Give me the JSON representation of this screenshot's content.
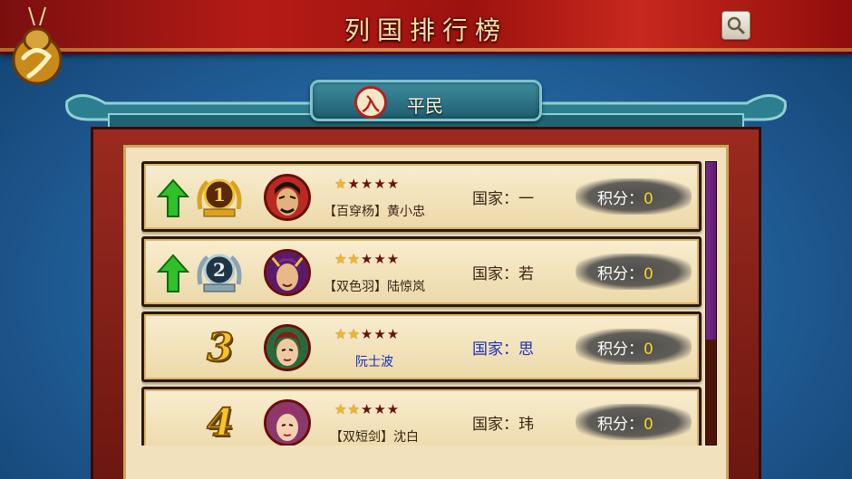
{
  "header": {
    "title": "列国排行榜"
  },
  "tab": {
    "badge": "入",
    "label": "平民"
  },
  "labels": {
    "country_prefix": "国家：",
    "score_prefix": "积分："
  },
  "rows": [
    {
      "rank": "1",
      "rank_style": "gold-medal",
      "trend": "up",
      "stars_filled": 1,
      "stars_total": 5,
      "name": "【百穿杨】黄小忠",
      "name_color": "default",
      "country": "一",
      "country_color": "default",
      "score": "0"
    },
    {
      "rank": "2",
      "rank_style": "silver-medal",
      "trend": "up",
      "stars_filled": 2,
      "stars_total": 5,
      "name": "【双色羽】陆惊岚",
      "name_color": "default",
      "country": "若",
      "country_color": "default",
      "score": "0"
    },
    {
      "rank": "3",
      "rank_style": "number",
      "trend": "none",
      "stars_filled": 2,
      "stars_total": 5,
      "name": "阮士波",
      "name_color": "blue",
      "country": "思",
      "country_color": "blue",
      "score": "0"
    },
    {
      "rank": "4",
      "rank_style": "number",
      "trend": "none",
      "stars_filled": 2,
      "stars_total": 5,
      "name": "【双短剑】沈白",
      "name_color": "default",
      "country": "玮",
      "country_color": "default",
      "score": "0"
    }
  ],
  "colors": {
    "accent_red": "#b5211a",
    "name_blue": "#1b2fb8",
    "score_yellow": "#f5d22a",
    "star_gold": "#f3b52a",
    "arrow_green": "#2fc02a"
  },
  "icons": {
    "search": "magnifier-icon",
    "back": "gourd-back-icon",
    "trend_up": "green-up-arrow-icon"
  }
}
